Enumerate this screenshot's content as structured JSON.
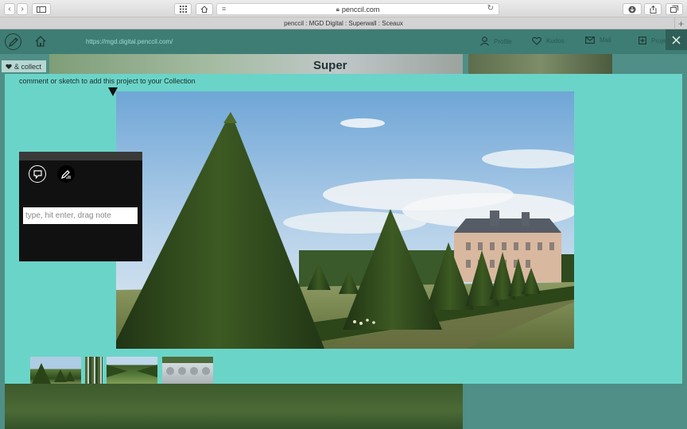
{
  "browser": {
    "url": "penccil.com",
    "tab_title": "penccil : MGD Digital : Superwall : Sceaux"
  },
  "app_nav": {
    "url": "https://mgd.digital.penccil.com/",
    "items": [
      {
        "label": "Profile",
        "icon": "profile-icon"
      },
      {
        "label": "Kudos",
        "icon": "heart-icon"
      },
      {
        "label": "Mail",
        "icon": "mail-icon"
      },
      {
        "label": "Projects",
        "icon": "plus-box-icon"
      }
    ]
  },
  "background_page": {
    "title_fragment": "Super"
  },
  "collect_tag": {
    "label": "& collect",
    "icon": "heart-icon"
  },
  "lightbox": {
    "hint": "comment or sketch to add this project to your Collection",
    "main_image_subject": "topiary cones garden chateau sceaux",
    "thumbnails": [
      "topiary garden",
      "trees",
      "lawn alley",
      "statues"
    ]
  },
  "note_panel": {
    "comment_icon": "comment-icon",
    "sketch_icon": "pencil-icon",
    "input_placeholder": "type, hit enter, drag note",
    "input_value": ""
  },
  "colors": {
    "lightbox_bg": "#6bd4c8",
    "nav_bg": "#3e7d74",
    "panel_bg": "#111111"
  }
}
